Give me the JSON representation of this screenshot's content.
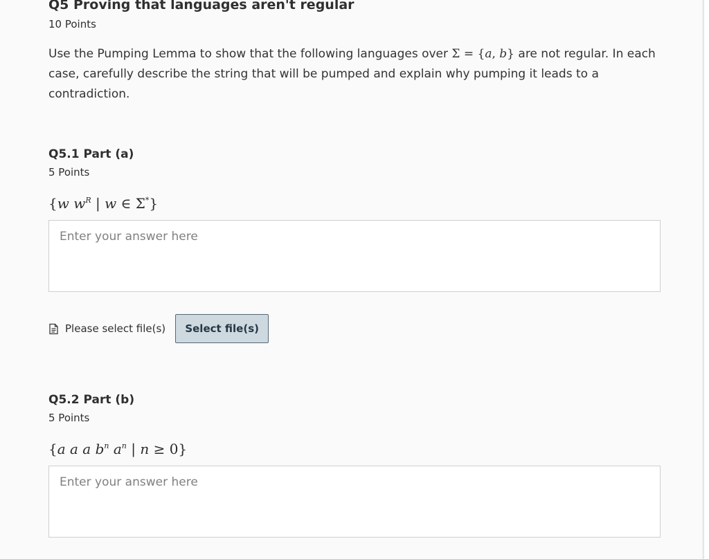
{
  "question": {
    "title": "Q5 Proving that languages aren't regular",
    "points": "10 Points",
    "intro_before": "Use the Pumping Lemma to show that the following languages over ",
    "intro_math": "Σ = {a, b}",
    "intro_after": " are not regular. In each case, carefully describe the string that will be pumped and explain why pumping it leads to a contradiction."
  },
  "parts": [
    {
      "title": "Q5.1 Part (a)",
      "points": "5 Points",
      "language": "{w w^R | w ∈ Σ*}",
      "answer_placeholder": "Enter your answer here",
      "answer_value": ""
    },
    {
      "title": "Q5.2 Part (b)",
      "points": "5 Points",
      "language": "{a a a b^n a^n | n ≥ 0}",
      "answer_placeholder": "Enter your answer here",
      "answer_value": ""
    }
  ],
  "file_upload": {
    "icon": "document-icon",
    "status_label": "Please select file(s)",
    "button_label": "Select file(s)"
  }
}
